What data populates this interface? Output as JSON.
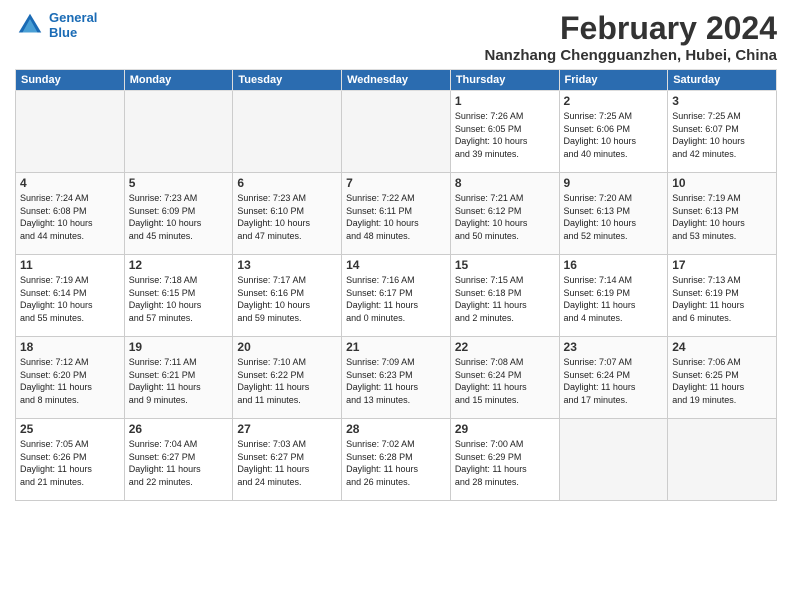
{
  "header": {
    "logo_line1": "General",
    "logo_line2": "Blue",
    "title": "February 2024",
    "subtitle": "Nanzhang Chengguanzhen, Hubei, China"
  },
  "weekdays": [
    "Sunday",
    "Monday",
    "Tuesday",
    "Wednesday",
    "Thursday",
    "Friday",
    "Saturday"
  ],
  "weeks": [
    [
      {
        "day": "",
        "info": ""
      },
      {
        "day": "",
        "info": ""
      },
      {
        "day": "",
        "info": ""
      },
      {
        "day": "",
        "info": ""
      },
      {
        "day": "1",
        "info": "Sunrise: 7:26 AM\nSunset: 6:05 PM\nDaylight: 10 hours\nand 39 minutes."
      },
      {
        "day": "2",
        "info": "Sunrise: 7:25 AM\nSunset: 6:06 PM\nDaylight: 10 hours\nand 40 minutes."
      },
      {
        "day": "3",
        "info": "Sunrise: 7:25 AM\nSunset: 6:07 PM\nDaylight: 10 hours\nand 42 minutes."
      }
    ],
    [
      {
        "day": "4",
        "info": "Sunrise: 7:24 AM\nSunset: 6:08 PM\nDaylight: 10 hours\nand 44 minutes."
      },
      {
        "day": "5",
        "info": "Sunrise: 7:23 AM\nSunset: 6:09 PM\nDaylight: 10 hours\nand 45 minutes."
      },
      {
        "day": "6",
        "info": "Sunrise: 7:23 AM\nSunset: 6:10 PM\nDaylight: 10 hours\nand 47 minutes."
      },
      {
        "day": "7",
        "info": "Sunrise: 7:22 AM\nSunset: 6:11 PM\nDaylight: 10 hours\nand 48 minutes."
      },
      {
        "day": "8",
        "info": "Sunrise: 7:21 AM\nSunset: 6:12 PM\nDaylight: 10 hours\nand 50 minutes."
      },
      {
        "day": "9",
        "info": "Sunrise: 7:20 AM\nSunset: 6:13 PM\nDaylight: 10 hours\nand 52 minutes."
      },
      {
        "day": "10",
        "info": "Sunrise: 7:19 AM\nSunset: 6:13 PM\nDaylight: 10 hours\nand 53 minutes."
      }
    ],
    [
      {
        "day": "11",
        "info": "Sunrise: 7:19 AM\nSunset: 6:14 PM\nDaylight: 10 hours\nand 55 minutes."
      },
      {
        "day": "12",
        "info": "Sunrise: 7:18 AM\nSunset: 6:15 PM\nDaylight: 10 hours\nand 57 minutes."
      },
      {
        "day": "13",
        "info": "Sunrise: 7:17 AM\nSunset: 6:16 PM\nDaylight: 10 hours\nand 59 minutes."
      },
      {
        "day": "14",
        "info": "Sunrise: 7:16 AM\nSunset: 6:17 PM\nDaylight: 11 hours\nand 0 minutes."
      },
      {
        "day": "15",
        "info": "Sunrise: 7:15 AM\nSunset: 6:18 PM\nDaylight: 11 hours\nand 2 minutes."
      },
      {
        "day": "16",
        "info": "Sunrise: 7:14 AM\nSunset: 6:19 PM\nDaylight: 11 hours\nand 4 minutes."
      },
      {
        "day": "17",
        "info": "Sunrise: 7:13 AM\nSunset: 6:19 PM\nDaylight: 11 hours\nand 6 minutes."
      }
    ],
    [
      {
        "day": "18",
        "info": "Sunrise: 7:12 AM\nSunset: 6:20 PM\nDaylight: 11 hours\nand 8 minutes."
      },
      {
        "day": "19",
        "info": "Sunrise: 7:11 AM\nSunset: 6:21 PM\nDaylight: 11 hours\nand 9 minutes."
      },
      {
        "day": "20",
        "info": "Sunrise: 7:10 AM\nSunset: 6:22 PM\nDaylight: 11 hours\nand 11 minutes."
      },
      {
        "day": "21",
        "info": "Sunrise: 7:09 AM\nSunset: 6:23 PM\nDaylight: 11 hours\nand 13 minutes."
      },
      {
        "day": "22",
        "info": "Sunrise: 7:08 AM\nSunset: 6:24 PM\nDaylight: 11 hours\nand 15 minutes."
      },
      {
        "day": "23",
        "info": "Sunrise: 7:07 AM\nSunset: 6:24 PM\nDaylight: 11 hours\nand 17 minutes."
      },
      {
        "day": "24",
        "info": "Sunrise: 7:06 AM\nSunset: 6:25 PM\nDaylight: 11 hours\nand 19 minutes."
      }
    ],
    [
      {
        "day": "25",
        "info": "Sunrise: 7:05 AM\nSunset: 6:26 PM\nDaylight: 11 hours\nand 21 minutes."
      },
      {
        "day": "26",
        "info": "Sunrise: 7:04 AM\nSunset: 6:27 PM\nDaylight: 11 hours\nand 22 minutes."
      },
      {
        "day": "27",
        "info": "Sunrise: 7:03 AM\nSunset: 6:27 PM\nDaylight: 11 hours\nand 24 minutes."
      },
      {
        "day": "28",
        "info": "Sunrise: 7:02 AM\nSunset: 6:28 PM\nDaylight: 11 hours\nand 26 minutes."
      },
      {
        "day": "29",
        "info": "Sunrise: 7:00 AM\nSunset: 6:29 PM\nDaylight: 11 hours\nand 28 minutes."
      },
      {
        "day": "",
        "info": ""
      },
      {
        "day": "",
        "info": ""
      }
    ]
  ]
}
